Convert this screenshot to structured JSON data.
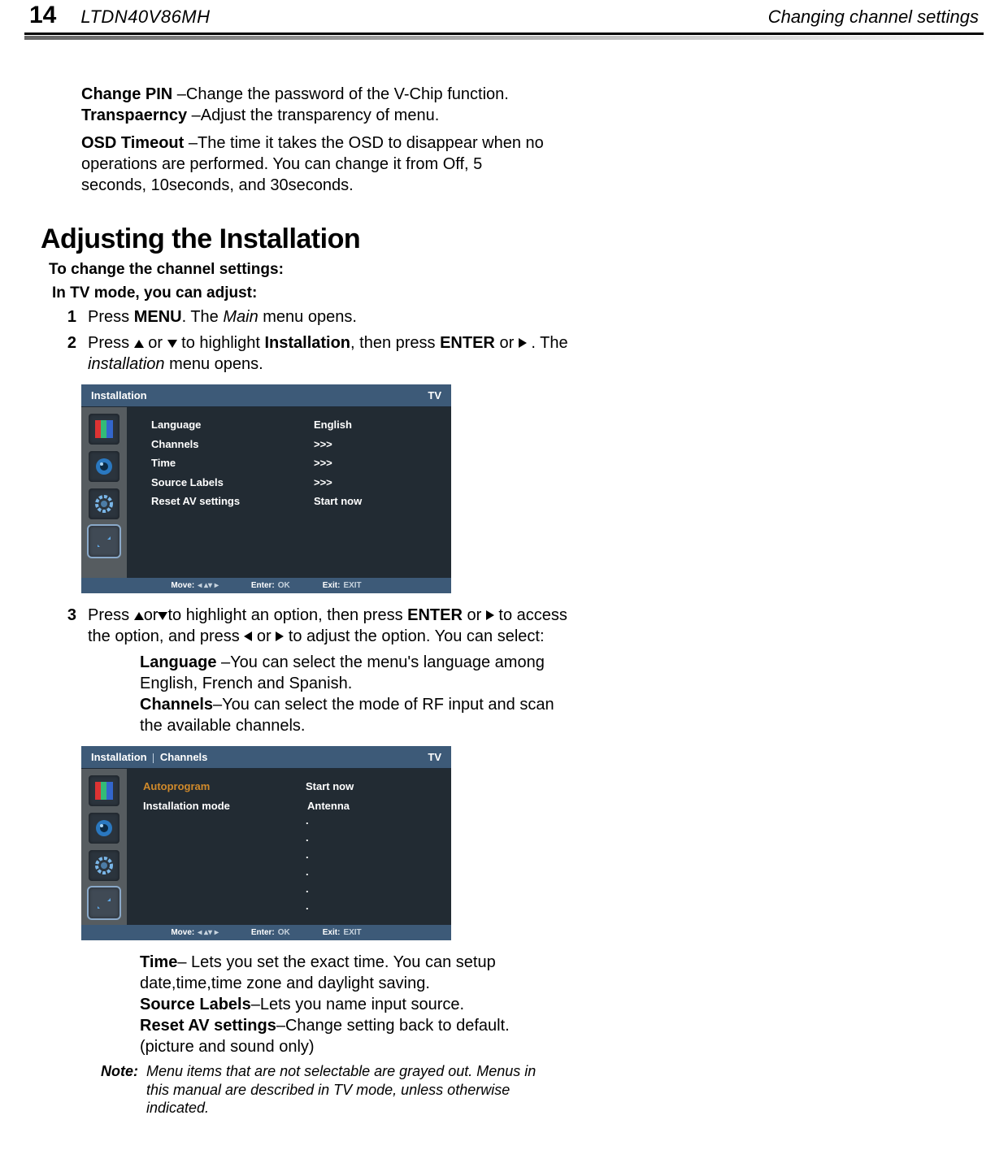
{
  "page": {
    "number": "14",
    "model": "LTDN40V86MH",
    "chapter": "Changing channel settings"
  },
  "intro": {
    "changePin_label": "Change PIN",
    "changePin_text": " –Change the password of the V-Chip function.",
    "transparency_label": "Transpaerncy",
    "transparency_text": " –Adjust the transparency of menu.",
    "osdTimeout_label": "OSD Timeout",
    "osdTimeout_text": " –The time it takes the OSD to disappear when no operations are performed. You can change it from Off, 5 seconds, 10seconds, and 30seconds."
  },
  "section_title": "Adjusting the Installation",
  "sub": {
    "line1": "To change the channel settings:",
    "line2": "In TV mode, you can adjust:"
  },
  "steps": {
    "s1": {
      "num": "1",
      "a": "Press ",
      "menu": "MENU",
      "b": ". The ",
      "main_i": "Main",
      "c": " menu opens."
    },
    "s2": {
      "num": "2",
      "a": "Press ",
      "b": " or ",
      "c": " to highlight ",
      "inst": "Installation",
      "d": ", then press ",
      "enter": "ENTER",
      "e": " or ",
      "f": " . The ",
      "inst_i": "installation",
      "g": " menu opens."
    },
    "s3": {
      "num": "3",
      "a": "Press ",
      "b": "or",
      "c": "to highlight an option, then press ",
      "enter": "ENTER",
      "d": " or ",
      "e": " to access the option, and press ",
      "f": " or ",
      "g": " to adjust  the option. You can select:"
    }
  },
  "osd1": {
    "title": "Installation",
    "mode": "TV",
    "rows": [
      {
        "label": "Language",
        "value": "English"
      },
      {
        "label": "Channels",
        "value": ">>>"
      },
      {
        "label": "Time",
        "value": ">>>"
      },
      {
        "label": "Source Labels",
        "value": ">>>"
      },
      {
        "label": "Reset AV settings",
        "value": "Start now"
      }
    ],
    "footer": {
      "move": "Move:",
      "move_k": "◂ ▴▾ ▸",
      "enter": "Enter:",
      "enter_k": "OK",
      "exit": "Exit:",
      "exit_k": "EXIT"
    }
  },
  "options_a": {
    "language_label": "Language",
    "language_text": " –You can select the menu's language among English, French and Spanish.",
    "channels_label": "Channels",
    "channels_text": "–You can select the mode of RF input and scan the available channels."
  },
  "osd2": {
    "title_a": "Installation",
    "title_b": "Channels",
    "mode": "TV",
    "rows": [
      {
        "label": "Autoprogram",
        "value": "Start now"
      },
      {
        "label": "Installation mode",
        "value": "Antenna"
      }
    ],
    "footer": {
      "move": "Move:",
      "move_k": "◂ ▴▾ ▸",
      "enter": "Enter:",
      "enter_k": "OK",
      "exit": "Exit:",
      "exit_k": "EXIT"
    }
  },
  "options_b": {
    "time_label": "Time",
    "time_text": "– Lets you set the exact time. You can setup date,time,time zone and daylight saving.",
    "source_label": "Source Labels",
    "source_text": "–Lets you name input source.",
    "reset_label": "Reset AV settings",
    "reset_text": "–Change setting back to default. (picture and sound only)"
  },
  "note": {
    "label": "Note:",
    "text": "Menu items that are not selectable are grayed out. Menus in this manual are described in TV mode, unless otherwise indicated."
  }
}
